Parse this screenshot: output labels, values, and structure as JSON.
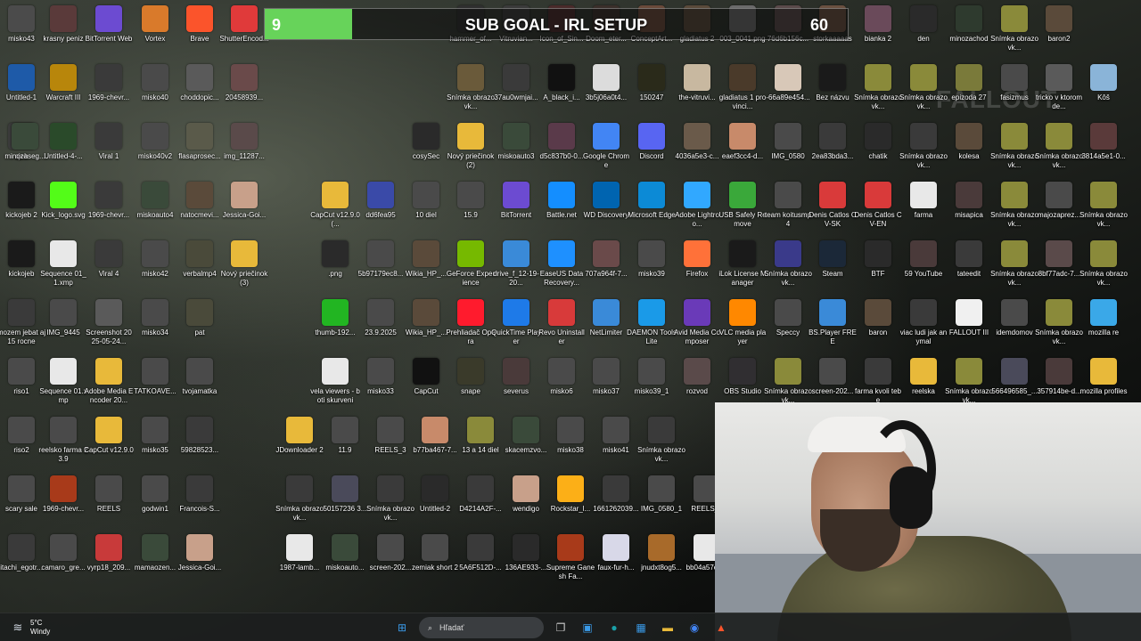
{
  "goal": {
    "current": "9",
    "title": "SUB GOAL - IRL SETUP",
    "target": "60",
    "progress": 0.15,
    "color": "#67d35a"
  },
  "watermark": "FALLOUT",
  "icons": [
    {
      "label": "misko43",
      "c": "#4b4b4b"
    },
    {
      "label": "krasny peniz",
      "c": "#5a3a3a"
    },
    {
      "label": "BitTorrent Web",
      "c": "#6c4bd1"
    },
    {
      "label": "Vortex",
      "c": "#d97a2b"
    },
    {
      "label": "Brave",
      "c": "#fb542b"
    },
    {
      "label": "ShutterEncod...",
      "c": "#e03a3a"
    },
    {
      "label": "hammer_of...",
      "c": "#2f2f2f"
    },
    {
      "label": "Vitruvian...",
      "c": "#3a3a3a"
    },
    {
      "label": "Icon_of_Sin...",
      "c": "#4a2a2a"
    },
    {
      "label": "Doom_eter...",
      "c": "#3a2f2a"
    },
    {
      "label": "ConceptArt...",
      "c": "#6a4a3a"
    },
    {
      "label": "gladiatus 2",
      "c": "#5a4a3a"
    },
    {
      "label": "003_0041.png",
      "c": "#6a6a6a"
    },
    {
      "label": "76d6b156c...",
      "c": "#5a4a4a"
    },
    {
      "label": "storkaaaaas",
      "c": "#6a5040"
    },
    {
      "label": "bianka 2",
      "c": "#6a4a5a"
    },
    {
      "label": "den",
      "c": "#2a2a2a"
    },
    {
      "label": "minozachod",
      "c": "#2e3a2e"
    },
    {
      "label": "Snímka obrazovk...",
      "c": "#8a8a3a"
    },
    {
      "label": "baron2",
      "c": "#5a4a3a"
    },
    {
      "label": "Untitled-1",
      "c": "#1e5aa8"
    },
    {
      "label": "Warcraft III",
      "c": "#b8860b"
    },
    {
      "label": "1969-chevr...",
      "c": "#3a3a3a"
    },
    {
      "label": "misko40",
      "c": "#4a4a4a"
    },
    {
      "label": "choddopic...",
      "c": "#5a5a5a"
    },
    {
      "label": "20458939...",
      "c": "#6a4a4a"
    },
    {
      "label": "Snímka obrazovk...",
      "c": "#6a5a3a"
    },
    {
      "label": "37au0wmjai...",
      "c": "#3a3a3a"
    },
    {
      "label": "A_black_i...",
      "c": "#111111"
    },
    {
      "label": "3b5j06a0t4...",
      "c": "#dcdcdc"
    },
    {
      "label": "150247",
      "c": "#2a2a1a"
    },
    {
      "label": "the-vitruvi...",
      "c": "#c8b8a0"
    },
    {
      "label": "gladiatus 1 provinci...",
      "c": "#4a3a2a"
    },
    {
      "label": "-66a89e454...",
      "c": "#d8c8b8"
    },
    {
      "label": "Bez názvu",
      "c": "#1a1a1a"
    },
    {
      "label": "Snímka obrazovk...",
      "c": "#8a8a3a"
    },
    {
      "label": "Snímka obrazovk...",
      "c": "#8a8a3a"
    },
    {
      "label": "epizoda 27",
      "c": "#7a7a3a"
    },
    {
      "label": "fasizmus",
      "c": "#4a4a4a"
    },
    {
      "label": "tricko v ktorom de...",
      "c": "#5a5a5a"
    },
    {
      "label": "Kôš",
      "c": "#8ab4d8"
    },
    {
      "label": "ojeb",
      "c": "#3a3a3a"
    },
    {
      "label": "Untitled-4-...",
      "c": "#2a4a2a"
    },
    {
      "label": "Viral 1",
      "c": "#3a3a3a"
    },
    {
      "label": "misko40v2",
      "c": "#4a4a4a"
    },
    {
      "label": "flasaprosec...",
      "c": "#5a5a4a"
    },
    {
      "label": "img_11287...",
      "c": "#5a4a4a"
    },
    {
      "label": "cosySec",
      "c": "#2a2a2a"
    },
    {
      "label": "Nový priečinok (2)",
      "c": "#e8b93a"
    },
    {
      "label": "miskoauto3",
      "c": "#3a4a3a"
    },
    {
      "label": "d5c837b0-0...",
      "c": "#5a3a4a"
    },
    {
      "label": "Google Chrome",
      "c": "#4285f4"
    },
    {
      "label": "Discord",
      "c": "#5865f2"
    },
    {
      "label": "4036a5e3-c...",
      "c": "#6a5a4a"
    },
    {
      "label": "eaef3cc4-d...",
      "c": "#c88a6a"
    },
    {
      "label": "IMG_0580",
      "c": "#4a4a4a"
    },
    {
      "label": "2ea83bda3...",
      "c": "#3a3a3a"
    },
    {
      "label": "chatik",
      "c": "#2a2a2a"
    },
    {
      "label": "Snímka obrazovk...",
      "c": "#3a3a3a"
    },
    {
      "label": "kolesa",
      "c": "#5a4a3a"
    },
    {
      "label": "Snímka obrazovk...",
      "c": "#8a8a3a"
    },
    {
      "label": "Snímka obrazovk...",
      "c": "#8a8a3a"
    },
    {
      "label": "3814a5e1-0...",
      "c": "#5a3a3a"
    },
    {
      "label": "minozaseg...",
      "c": "#3a4a3a"
    },
    {
      "label": "kickojeb 2",
      "c": "#1a1a1a"
    },
    {
      "label": "Kick_logo.svg",
      "c": "#53fc18"
    },
    {
      "label": "1969-chevr...",
      "c": "#3a3a3a"
    },
    {
      "label": "miskoauto4",
      "c": "#3a4a3a"
    },
    {
      "label": "natocmevi...",
      "c": "#5a4a3a"
    },
    {
      "label": "Jessica-Goi...",
      "c": "#c8a08a"
    },
    {
      "label": "CapCut v12.9.0 (...",
      "c": "#e8b93a"
    },
    {
      "label": "dd6fea95",
      "c": "#3a4aa8"
    },
    {
      "label": "10 diel",
      "c": "#4a4a4a"
    },
    {
      "label": "15.9",
      "c": "#4a4a4a"
    },
    {
      "label": "BitTorrent",
      "c": "#6c4bd1"
    },
    {
      "label": "Battle.net",
      "c": "#148eff"
    },
    {
      "label": "WD Discovery",
      "c": "#0064b0"
    },
    {
      "label": "Microsoft Edge",
      "c": "#0c8ad6"
    },
    {
      "label": "Adobe Lightroo...",
      "c": "#31a8ff"
    },
    {
      "label": "USB Safely Remove",
      "c": "#3aa83a"
    },
    {
      "label": "team koitusmp4",
      "c": "#4a4a4a"
    },
    {
      "label": "Denis Catlos CV-SK",
      "c": "#d93a3a"
    },
    {
      "label": "Denis Catlos CV-EN",
      "c": "#d93a3a"
    },
    {
      "label": "farma",
      "c": "#e8e8e8"
    },
    {
      "label": "misapica",
      "c": "#4a3a3a"
    },
    {
      "label": "Snímka obrazovk...",
      "c": "#8a8a3a"
    },
    {
      "label": "majozaprez...",
      "c": "#4a4a4a"
    },
    {
      "label": "Snímka obrazovk...",
      "c": "#8a8a3a"
    },
    {
      "label": "kickojeb",
      "c": "#1a1a1a"
    },
    {
      "label": "Sequence 01_1.xmp",
      "c": "#e8e8e8"
    },
    {
      "label": "Viral 4",
      "c": "#3a3a3a"
    },
    {
      "label": "misko42",
      "c": "#4a4a4a"
    },
    {
      "label": "verbalmp4",
      "c": "#4a4a3a"
    },
    {
      "label": "Nový priečinok (3)",
      "c": "#e8b93a"
    },
    {
      "label": ".png",
      "c": "#2a2a2a"
    },
    {
      "label": "5b97179ec8...",
      "c": "#4a4a4a"
    },
    {
      "label": "Wikia_HP_...",
      "c": "#5a4a3a"
    },
    {
      "label": "GeForce Experience",
      "c": "#76b900"
    },
    {
      "label": "drive_f_12-19-20...",
      "c": "#3a8ad8"
    },
    {
      "label": "EaseUS Data Recovery...",
      "c": "#1e90ff"
    },
    {
      "label": "707a964f-7...",
      "c": "#6a4a4a"
    },
    {
      "label": "misko39",
      "c": "#4a4a4a"
    },
    {
      "label": "Firefox",
      "c": "#ff7139"
    },
    {
      "label": "iLok License Manager",
      "c": "#1a1a1a"
    },
    {
      "label": "Snímka obrazovk...",
      "c": "#3a3a8a"
    },
    {
      "label": "Steam",
      "c": "#1b2838"
    },
    {
      "label": "BTF",
      "c": "#2a2a2a"
    },
    {
      "label": "59 YouTube",
      "c": "#4a3a3a"
    },
    {
      "label": "tateedit",
      "c": "#3a3a3a"
    },
    {
      "label": "Snímka obrazovk...",
      "c": "#8a8a3a"
    },
    {
      "label": "8bf77adc-7...",
      "c": "#5a4a4a"
    },
    {
      "label": "Snímka obrazovk...",
      "c": "#8a8a3a"
    },
    {
      "label": "mozem jebat aj 15 rocne",
      "c": "#3a3a3a"
    },
    {
      "label": "IMG_9445",
      "c": "#4a4a4a"
    },
    {
      "label": "Screenshot 2025-05-24...",
      "c": "#5a5a5a"
    },
    {
      "label": "misko34",
      "c": "#4a4a4a"
    },
    {
      "label": "pat",
      "c": "#4a4a3a"
    },
    {
      "label": "thumb-192...",
      "c": "#22b522"
    },
    {
      "label": "23.9.2025",
      "c": "#4a4a4a"
    },
    {
      "label": "Wikia_HP_...",
      "c": "#5a4a3a"
    },
    {
      "label": "Prehliadač Opera",
      "c": "#ff1b2d"
    },
    {
      "label": "QuickTime Player",
      "c": "#1e7ae8"
    },
    {
      "label": "Revo Uninstaller",
      "c": "#d83a3a"
    },
    {
      "label": "NetLimiter",
      "c": "#3a8ad8"
    },
    {
      "label": "DAEMON Tools Lite",
      "c": "#1a9ae8"
    },
    {
      "label": "Avid Media Composer",
      "c": "#6a3ab8"
    },
    {
      "label": "VLC media player",
      "c": "#ff8800"
    },
    {
      "label": "Speccy",
      "c": "#4a4a4a"
    },
    {
      "label": "BS.Player FREE",
      "c": "#3a8ad8"
    },
    {
      "label": "baron",
      "c": "#5a4a3a"
    },
    {
      "label": "viac ludi jak anymal",
      "c": "#3a3a3a"
    },
    {
      "label": "FALLOUT III",
      "c": "#f0f0f0"
    },
    {
      "label": "idemdomov",
      "c": "#4a4a4a"
    },
    {
      "label": "Snímka obrazovk...",
      "c": "#8a8a3a"
    },
    {
      "label": "mozilla re",
      "c": "#3aa8e8"
    },
    {
      "label": "riso1",
      "c": "#4a4a4a"
    },
    {
      "label": "Sequence 01.xmp",
      "c": "#e8e8e8"
    },
    {
      "label": "Adobe Media Encoder 20...",
      "c": "#e8b93a"
    },
    {
      "label": "TATKOAVE...",
      "c": "#4a4a4a"
    },
    {
      "label": "tvojamatka",
      "c": "#4a4a4a"
    },
    {
      "label": "vela viewers - boti skurveni",
      "c": "#e8e8e8"
    },
    {
      "label": "misko33",
      "c": "#4a4a4a"
    },
    {
      "label": "CapCut",
      "c": "#111111"
    },
    {
      "label": "snape",
      "c": "#3a3a2a"
    },
    {
      "label": "severus",
      "c": "#4a3a3a"
    },
    {
      "label": "misko6",
      "c": "#4a4a4a"
    },
    {
      "label": "misko37",
      "c": "#4a4a4a"
    },
    {
      "label": "misko39_1",
      "c": "#4a4a4a"
    },
    {
      "label": "rozvod",
      "c": "#5a4a4a"
    },
    {
      "label": "OBS Studio",
      "c": "#302e31"
    },
    {
      "label": "Snímka obrazovk...",
      "c": "#8a8a3a"
    },
    {
      "label": "screen-202...",
      "c": "#4a4a4a"
    },
    {
      "label": "farma kvoli tebe",
      "c": "#3a3a3a"
    },
    {
      "label": "reelska",
      "c": "#e8b93a"
    },
    {
      "label": "Snímka obrazovk...",
      "c": "#8a8a3a"
    },
    {
      "label": "566496585_...",
      "c": "#4a4a5a"
    },
    {
      "label": "357914be-d...",
      "c": "#4a3a3a"
    },
    {
      "label": "mozilla profiles",
      "c": "#e8b93a"
    },
    {
      "label": "riso2",
      "c": "#4a4a4a"
    },
    {
      "label": "reelsko farma 23.9",
      "c": "#4a4a4a"
    },
    {
      "label": "CapCut v12.9.0",
      "c": "#e8b93a"
    },
    {
      "label": "misko35",
      "c": "#4a4a4a"
    },
    {
      "label": "59828523...",
      "c": "#3a3a3a"
    },
    {
      "label": "JDownloader 2",
      "c": "#e8b93a"
    },
    {
      "label": "11.9",
      "c": "#4a4a4a"
    },
    {
      "label": "REELS_3",
      "c": "#4a4a4a"
    },
    {
      "label": "b77ba467-7...",
      "c": "#c88a6a"
    },
    {
      "label": "13 a 14 diel",
      "c": "#8a8a3a"
    },
    {
      "label": "skacemzvo...",
      "c": "#3a4a3a"
    },
    {
      "label": "misko38",
      "c": "#4a4a4a"
    },
    {
      "label": "misko41",
      "c": "#4a4a4a"
    },
    {
      "label": "Snímka obrazovk...",
      "c": "#3a3a3a"
    },
    {
      "label": "scary sale",
      "c": "#4a4a4a"
    },
    {
      "label": "1969-chevr...",
      "c": "#a83a1a"
    },
    {
      "label": "REELS",
      "c": "#4a4a4a"
    },
    {
      "label": "godwin1",
      "c": "#4a4a4a"
    },
    {
      "label": "Francois-S...",
      "c": "#3a3a3a"
    },
    {
      "label": "Snímka obrazovk...",
      "c": "#3a3a3a"
    },
    {
      "label": "50157236 3...",
      "c": "#4a4a5a"
    },
    {
      "label": "Snímka obrazovk...",
      "c": "#3a3a3a"
    },
    {
      "label": "Untitled-2",
      "c": "#2a2a2a"
    },
    {
      "label": "D4214A2F-...",
      "c": "#3a3a3a"
    },
    {
      "label": "wendigo",
      "c": "#c8a08a"
    },
    {
      "label": "Rockstar_l...",
      "c": "#fcaf17"
    },
    {
      "label": "1661262039...",
      "c": "#3a3a3a"
    },
    {
      "label": "IMG_0580_1",
      "c": "#4a4a4a"
    },
    {
      "label": "REELS_2",
      "c": "#4a4a4a"
    },
    {
      "label": "itachi_egotr...",
      "c": "#3a3a3a"
    },
    {
      "label": "camaro_gre...",
      "c": "#4a4a4a"
    },
    {
      "label": "vyrp18_209...",
      "c": "#c83a3a"
    },
    {
      "label": "mamaozen...",
      "c": "#3a4a3a"
    },
    {
      "label": "Jessica-Goi...",
      "c": "#c8a08a"
    },
    {
      "label": "1987-lamb...",
      "c": "#e8e8e8"
    },
    {
      "label": "miskoauto...",
      "c": "#3a4a3a"
    },
    {
      "label": "screen-202...",
      "c": "#4a4a4a"
    },
    {
      "label": "zemiak short 2",
      "c": "#4a4a4a"
    },
    {
      "label": "5A6F512D-...",
      "c": "#3a3a3a"
    },
    {
      "label": "136AE933-...",
      "c": "#2a2a2a"
    },
    {
      "label": "Supreme Ganesh Fa...",
      "c": "#a83a1a"
    },
    {
      "label": "faux-fur-h...",
      "c": "#d8d8e8"
    },
    {
      "label": "jnudxt8og5...",
      "c": "#a86a2a"
    },
    {
      "label": "bb04a57eb...",
      "c": "#e8e8e8"
    }
  ],
  "taskbar": {
    "weather_temp": "5°C",
    "weather_desc": "Windy",
    "search_placeholder": "Hľadať",
    "apps": [
      {
        "name": "start",
        "glyph": "⊞",
        "c": "#3a9ae8"
      },
      {
        "name": "task-view",
        "glyph": "❐",
        "c": "#cccccc"
      },
      {
        "name": "store",
        "glyph": "▣",
        "c": "#3a9ae8"
      },
      {
        "name": "edge",
        "glyph": "●",
        "c": "#1aa0a8"
      },
      {
        "name": "photos",
        "glyph": "▦",
        "c": "#3a9ae8"
      },
      {
        "name": "file-explorer",
        "glyph": "▬",
        "c": "#e8b93a"
      },
      {
        "name": "chrome",
        "glyph": "◉",
        "c": "#4285f4"
      },
      {
        "name": "brave",
        "glyph": "▲",
        "c": "#fb542b"
      }
    ]
  }
}
